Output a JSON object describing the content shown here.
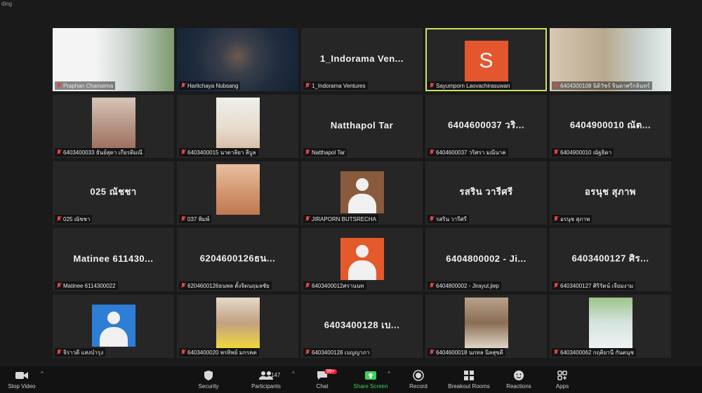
{
  "window": {
    "title": "ding"
  },
  "tiles": [
    {
      "label": "Praphan Chansema",
      "name": "",
      "kind": "photo",
      "photo": "presenter"
    },
    {
      "label": "Haritchaya Nubsang",
      "name": "",
      "kind": "photo",
      "photo": "glasses"
    },
    {
      "label": "1_Indorama Ventures",
      "name": "1_Indorama Ven...",
      "kind": "name"
    },
    {
      "label": "Sayumporn Laovachirasuwan",
      "name": "",
      "kind": "letter",
      "letter": "S",
      "active": true
    },
    {
      "label": "6404300108 นิติวัชร์ จินดาศรีกลินทร์",
      "name": "",
      "kind": "photo",
      "photo": "room"
    },
    {
      "label": "6403400033 ธันย์สุดา เกียรติมณี",
      "name": "",
      "kind": "photo",
      "photo": "girl1"
    },
    {
      "label": "6403400015 นาตาลิยา ลีบูล",
      "name": "",
      "kind": "photo",
      "photo": "girl2"
    },
    {
      "label": "Natthapol Tar",
      "name": "Natthapol Tar",
      "kind": "name"
    },
    {
      "label": "6404600037 วริศรา มณีนาค",
      "name": "6404600037 วริ...",
      "kind": "name"
    },
    {
      "label": "6404900010 ณัฐธิดา",
      "name": "6404900010 ณัต...",
      "kind": "name"
    },
    {
      "label": "025 ณัชชา",
      "name": "025 ณัชชา",
      "kind": "name"
    },
    {
      "label": "037 พิมพ์",
      "name": "",
      "kind": "photo",
      "photo": "girl3"
    },
    {
      "label": "JIRAPORN BUTSRECHA",
      "name": "",
      "kind": "person",
      "bg": "#8a5a3c"
    },
    {
      "label": "รสริน วารีศรี",
      "name": "รสริน วารีศรี",
      "kind": "name"
    },
    {
      "label": "อรนุช สุภาพ",
      "name": "อรนุช สุภาพ",
      "kind": "name"
    },
    {
      "label": "Matinee 6114300022",
      "name": "Matinee 611430...",
      "kind": "name"
    },
    {
      "label": "6204600126ธนพล ตั้งจิตนฤมลชัย",
      "name": "6204600126ธน...",
      "kind": "name"
    },
    {
      "label": "6403400012ศรานนท",
      "name": "",
      "kind": "person",
      "bg": "#e55a2a"
    },
    {
      "label": "6404800002 - Jirayut.jiep",
      "name": "6404800002 - Ji...",
      "kind": "name"
    },
    {
      "label": "6403400127 ศิริรัตน์ เจียมงาม",
      "name": "6403400127 ศิร...",
      "kind": "name"
    },
    {
      "label": "จิราวดี แสงบำรุง",
      "name": "",
      "kind": "person",
      "bg": "#2d7ed4"
    },
    {
      "label": "6403400020 พรทิพย์ มกรคต",
      "name": "",
      "kind": "photo",
      "photo": "girl4"
    },
    {
      "label": "6403400128 เบญญาภา",
      "name": "6403400128 เบ...",
      "kind": "name"
    },
    {
      "label": "6404600018 นภทล นิลสุขดี",
      "name": "",
      "kind": "photo",
      "photo": "boy1"
    },
    {
      "label": "6403400062 กฤติยานี กันตนุช",
      "name": "",
      "kind": "photo",
      "photo": "boy2"
    }
  ],
  "toolbar": {
    "stop_video": "Stop Video",
    "security": "Security",
    "participants": "Participants",
    "participants_count": "147",
    "chat": "Chat",
    "chat_badge": "99+",
    "share_screen": "Share Screen",
    "record": "Record",
    "breakout_rooms": "Breakout Rooms",
    "reactions": "Reactions",
    "apps": "Apps"
  },
  "colors": {
    "active_border": "#c9e26a",
    "share_green": "#3ecf5a",
    "badge_red": "#e0283a"
  }
}
